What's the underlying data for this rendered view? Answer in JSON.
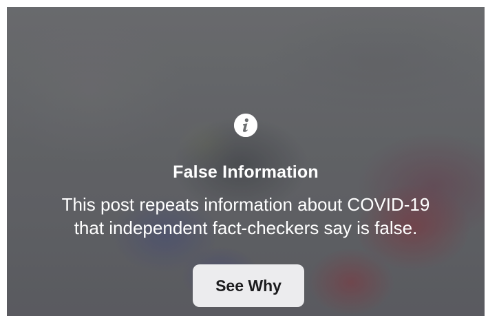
{
  "warning": {
    "icon": "info-icon",
    "title": "False Information",
    "message_line1": "This post repeats information about COVID-19",
    "message_line2": "that independent fact-checkers say is false.",
    "button_label": "See Why"
  },
  "colors": {
    "overlay": "#6b6e70",
    "text": "#ffffff",
    "button_bg": "#ececee",
    "button_text": "#1c1c1e"
  }
}
